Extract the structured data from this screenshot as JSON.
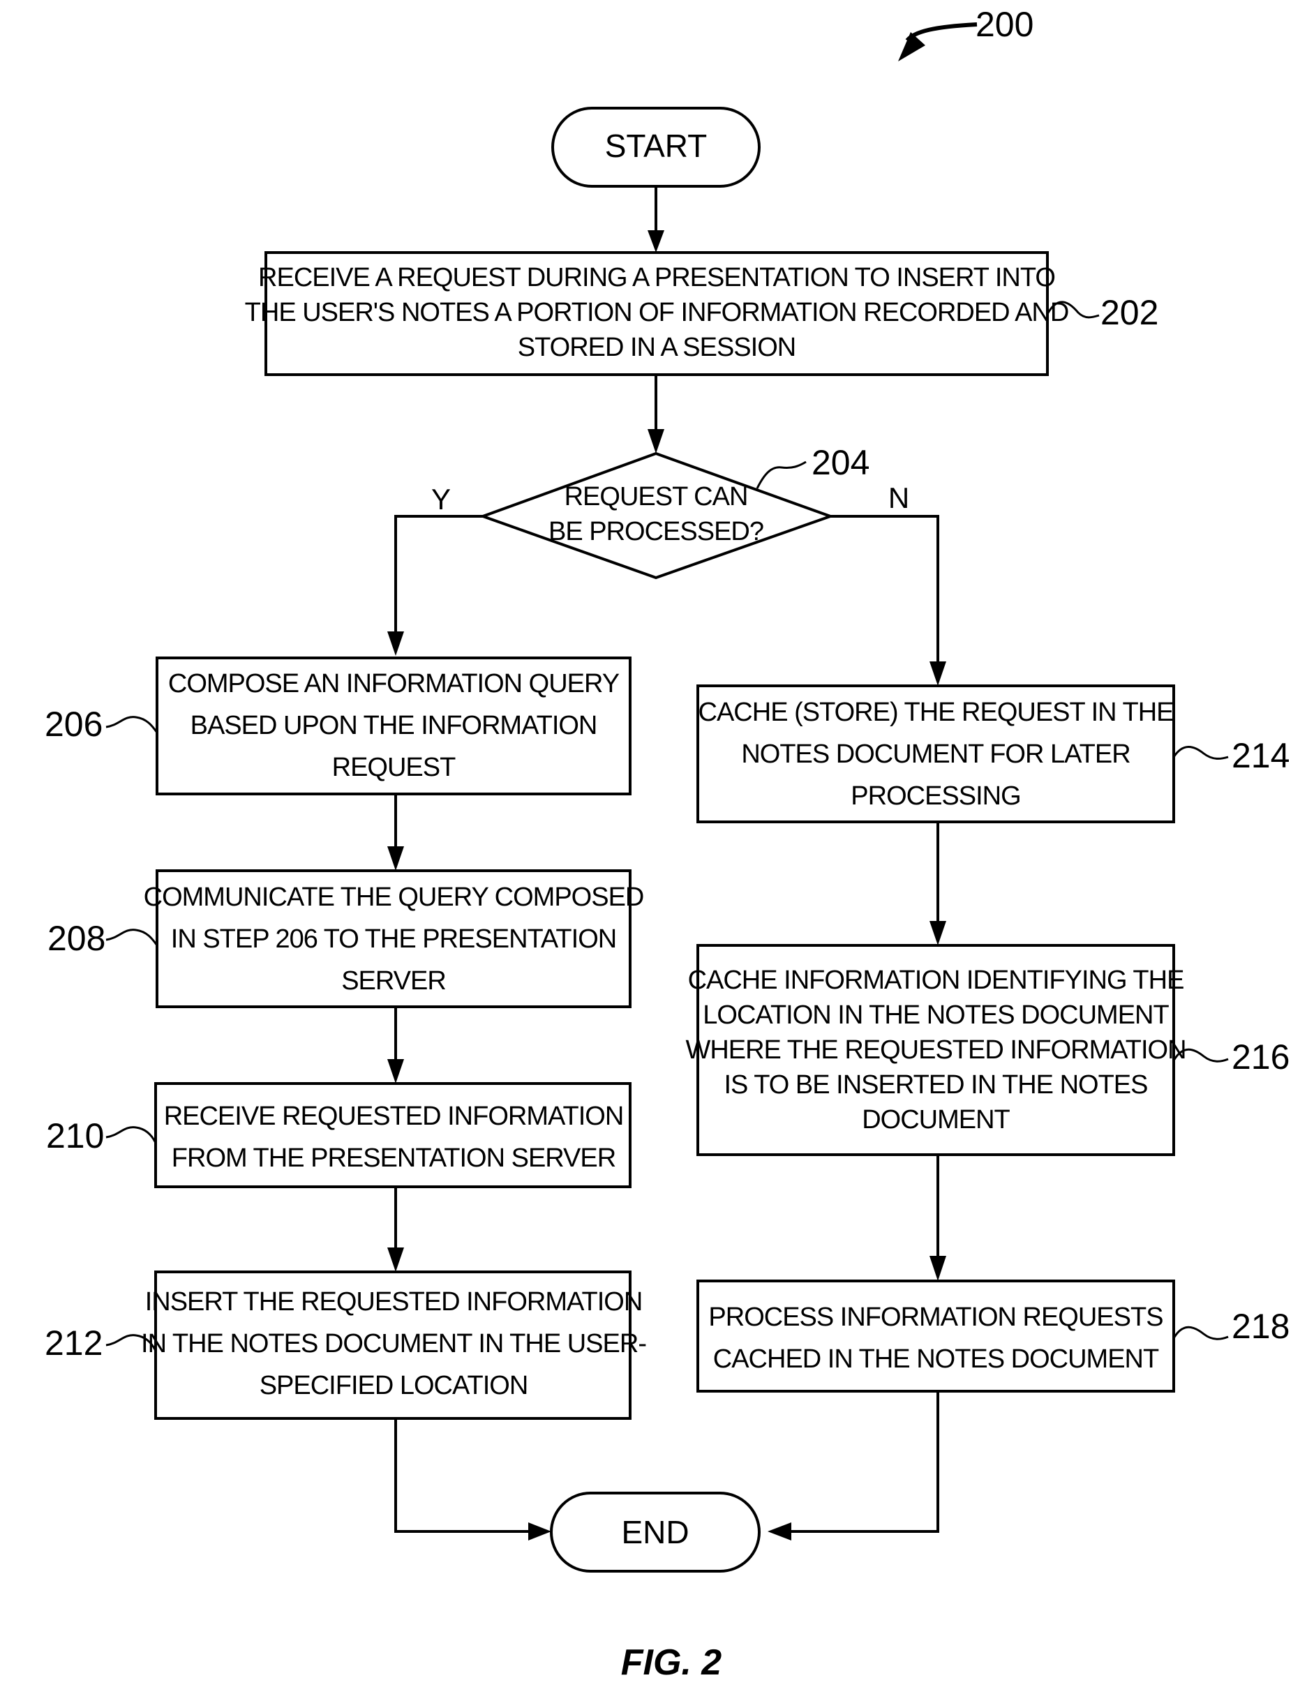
{
  "figure": {
    "ref": "200",
    "caption": "FIG. 2"
  },
  "start": {
    "label": "START"
  },
  "end": {
    "label": "END"
  },
  "steps": {
    "s202": {
      "ref": "202",
      "lines": [
        "RECEIVE A REQUEST DURING A PRESENTATION TO INSERT INTO",
        "THE USER'S NOTES A PORTION OF INFORMATION RECORDED AND",
        "STORED IN A SESSION"
      ]
    },
    "s204": {
      "ref": "204",
      "lines": [
        "REQUEST CAN",
        "BE PROCESSED?"
      ],
      "yes_label": "Y",
      "no_label": "N"
    },
    "s206": {
      "ref": "206",
      "lines": [
        "COMPOSE AN INFORMATION QUERY",
        "BASED UPON THE INFORMATION",
        "REQUEST"
      ]
    },
    "s208": {
      "ref": "208",
      "lines": [
        "COMMUNICATE THE QUERY COMPOSED",
        "IN STEP 206 TO THE PRESENTATION",
        "SERVER"
      ]
    },
    "s210": {
      "ref": "210",
      "lines": [
        "RECEIVE REQUESTED INFORMATION",
        "FROM THE PRESENTATION SERVER"
      ]
    },
    "s212": {
      "ref": "212",
      "lines": [
        "INSERT THE REQUESTED INFORMATION",
        "IN THE NOTES DOCUMENT IN THE USER-",
        "SPECIFIED LOCATION"
      ]
    },
    "s214": {
      "ref": "214",
      "lines": [
        "CACHE (STORE) THE REQUEST IN THE",
        "NOTES DOCUMENT FOR LATER",
        "PROCESSING"
      ]
    },
    "s216": {
      "ref": "216",
      "lines": [
        "CACHE INFORMATION IDENTIFYING THE",
        "LOCATION IN THE NOTES DOCUMENT",
        "WHERE THE REQUESTED INFORMATION",
        "IS TO BE INSERTED IN THE NOTES",
        "DOCUMENT"
      ]
    },
    "s218": {
      "ref": "218",
      "lines": [
        "PROCESS INFORMATION REQUESTS",
        "CACHED IN THE NOTES DOCUMENT"
      ]
    }
  }
}
